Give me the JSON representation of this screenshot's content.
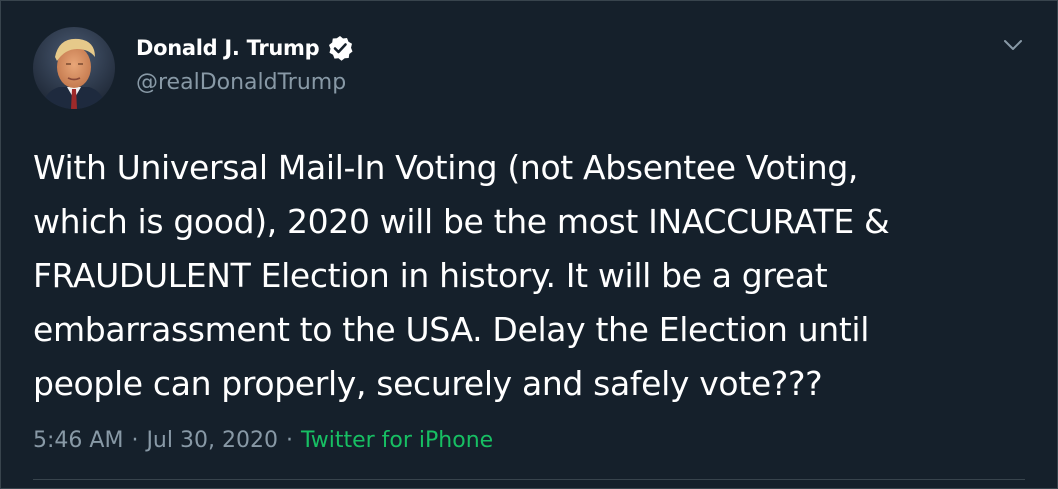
{
  "author": {
    "display_name": "Donald J. Trump",
    "handle": "@realDonaldTrump",
    "verified_icon": "verified-badge-icon",
    "avatar_icon": "profile-photo"
  },
  "tweet": {
    "lines": [
      "With Universal Mail-In Voting (not Absentee Voting,",
      "which is good), 2020 will be the most INACCURATE &",
      "FRAUDULENT Election in history. It will be a great",
      "embarrassment to the USA. Delay the Election until",
      "people can properly, securely and safely vote???"
    ]
  },
  "meta": {
    "time": "5:46 AM",
    "separator": "·",
    "date": "Jul 30, 2020",
    "source": "Twitter for iPhone"
  },
  "menu": {
    "icon": "chevron-down-icon"
  },
  "colors": {
    "background": "#15202b",
    "text_primary": "#ffffff",
    "text_secondary": "#8899a6",
    "source_link": "#17bf63",
    "border": "#38444d"
  }
}
